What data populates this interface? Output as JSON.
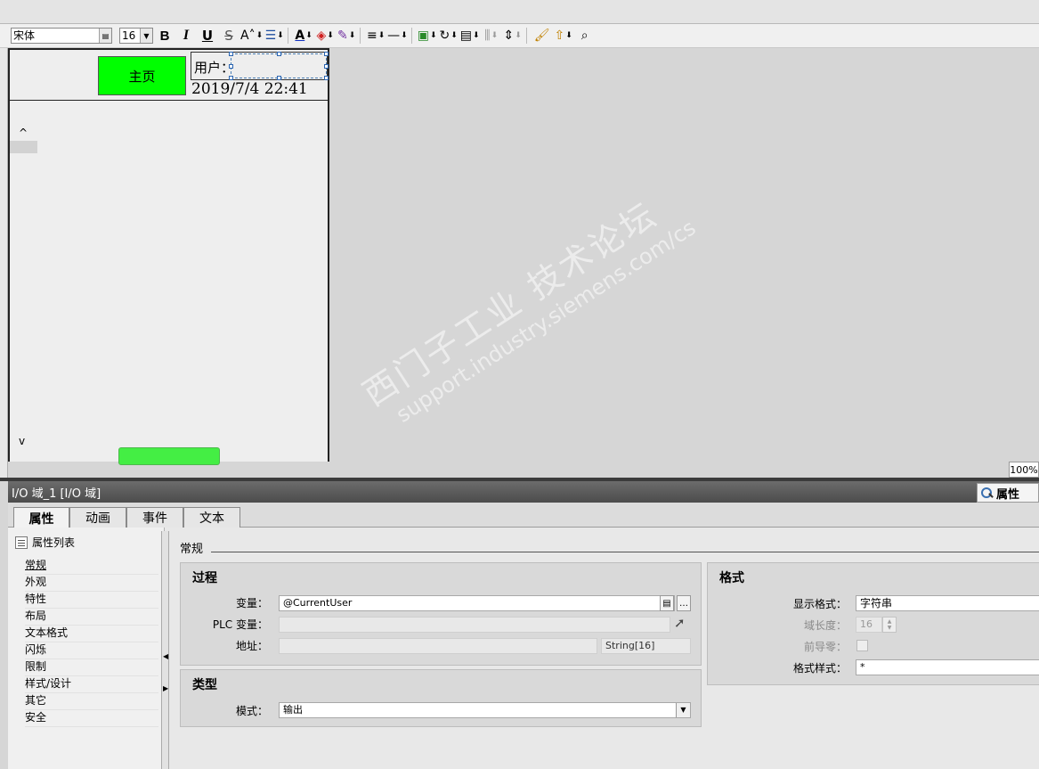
{
  "toolbar": {
    "font_name": "宋体",
    "font_size": "16",
    "bold": "B",
    "italic": "I",
    "underline": "U",
    "strike": "S"
  },
  "screen": {
    "home_button": "主页",
    "user_label": "用户：",
    "datetime": "2019/7/4 22:41",
    "scroll_up": "^",
    "scroll_down": "v"
  },
  "zoom": "100%",
  "inspector": {
    "header_title": "I/O 域_1 [I/O 域]",
    "properties_button": "属性",
    "tabs": [
      {
        "label": "属性"
      },
      {
        "label": "动画"
      },
      {
        "label": "事件"
      },
      {
        "label": "文本"
      }
    ],
    "nav_title": "属性列表",
    "nav_items": [
      "常规",
      "外观",
      "特性",
      "布局",
      "文本格式",
      "闪烁",
      "限制",
      "样式/设计",
      "其它",
      "安全"
    ],
    "section_title": "常规",
    "process": {
      "title": "过程",
      "variable_label": "变量：",
      "variable_value": "@CurrentUser",
      "plc_variable_label": "PLC 变量：",
      "plc_variable_value": "",
      "address_label": "地址：",
      "address_value": "",
      "address_type": "String[16]"
    },
    "type": {
      "title": "类型",
      "mode_label": "模式：",
      "mode_value": "输出"
    },
    "format": {
      "title": "格式",
      "display_format_label": "显示格式：",
      "display_format_value": "字符串",
      "field_length_label": "域长度：",
      "field_length_value": "16",
      "leading_zero_label": "前导零：",
      "format_style_label": "格式样式：",
      "format_style_value": "*"
    }
  },
  "watermark": {
    "line1": "西门子工业 技术论坛",
    "line2": "support.industry.siemens.com/cs"
  },
  "colors": {
    "home_button": "#00ff00",
    "header_bar": "#5a5a5a",
    "selection_handle": "#2a64b0"
  }
}
